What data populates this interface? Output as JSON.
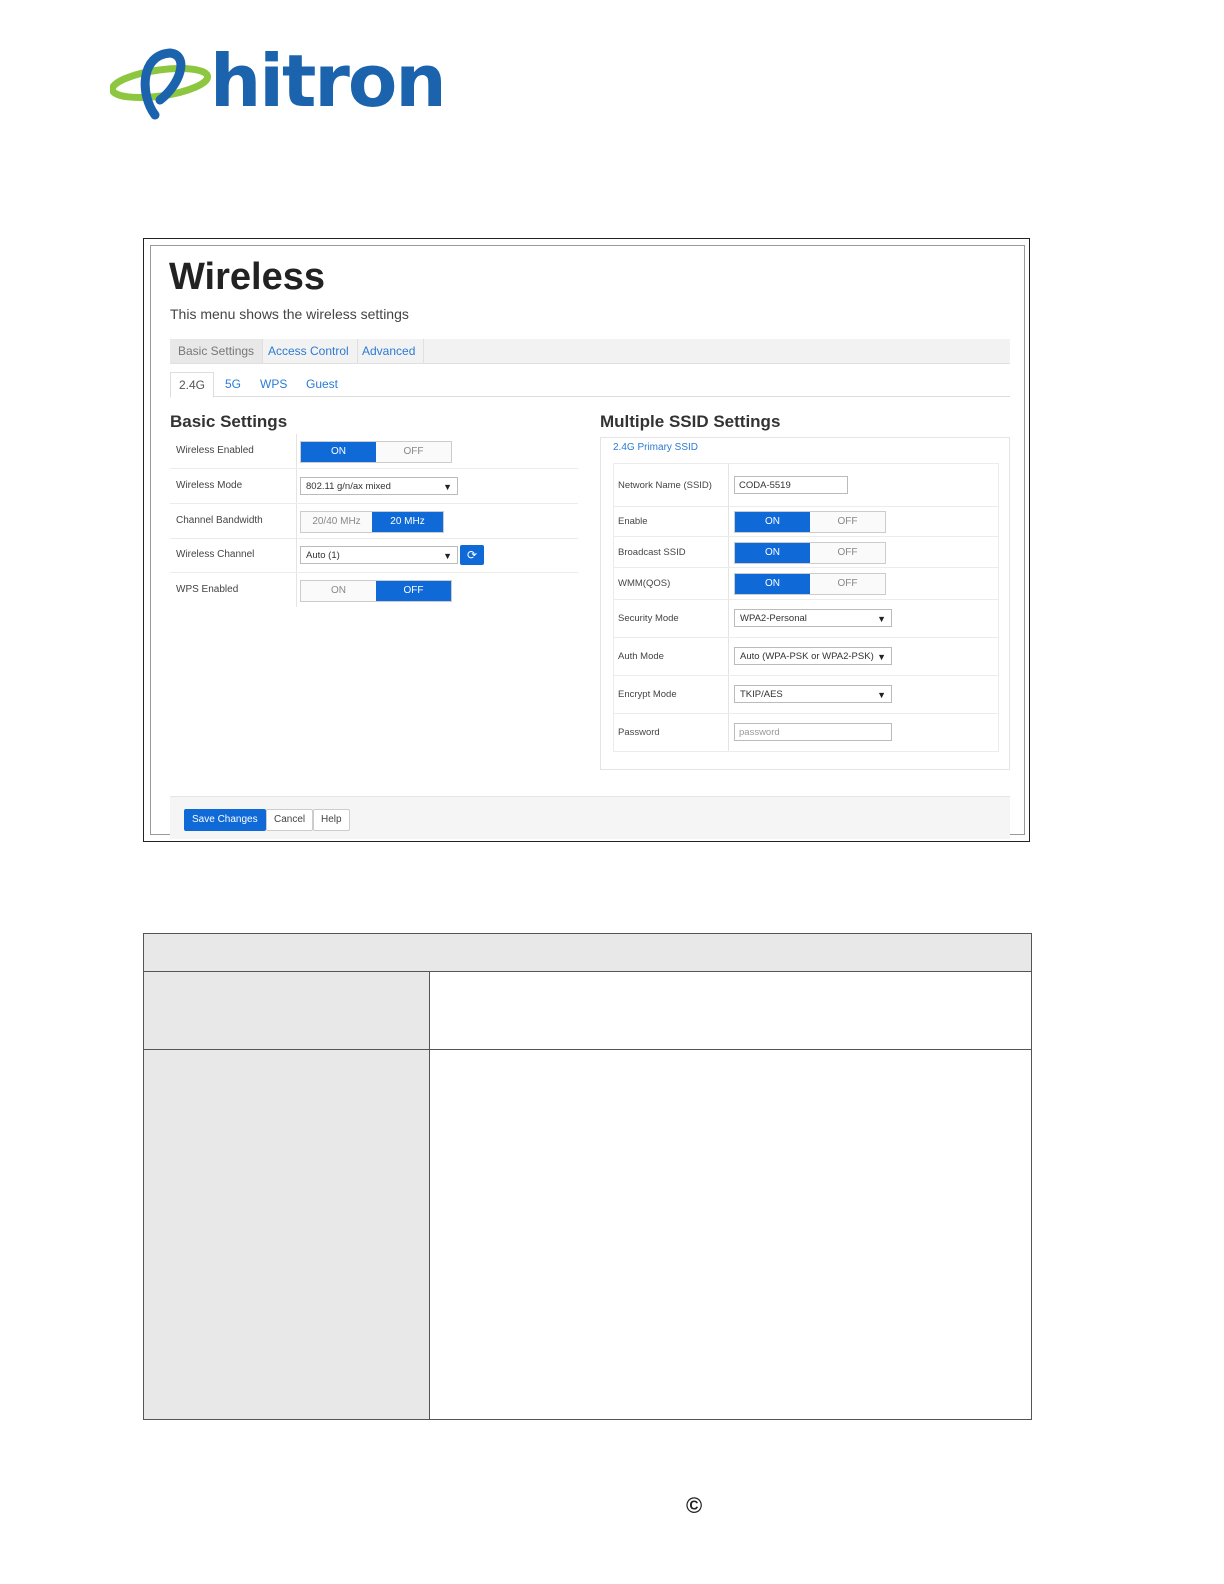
{
  "brand": {
    "name": "hitron",
    "primary_color": "#1b64ad",
    "accent_color": "#8dc63f"
  },
  "screen": {
    "title": "Wireless",
    "subtitle": "This menu shows the wireless settings",
    "top_tabs": [
      {
        "label": "Basic Settings",
        "active": true
      },
      {
        "label": "Access Control",
        "active": false
      },
      {
        "label": "Advanced",
        "active": false
      }
    ],
    "band_tabs": [
      {
        "label": "2.4G",
        "active": true
      },
      {
        "label": "5G",
        "active": false
      },
      {
        "label": "WPS",
        "active": false
      },
      {
        "label": "Guest",
        "active": false
      }
    ],
    "basic": {
      "title": "Basic Settings",
      "wireless_enabled": {
        "label": "Wireless Enabled",
        "on": "ON",
        "off": "OFF",
        "state": "on"
      },
      "wireless_mode": {
        "label": "Wireless Mode",
        "value": "802.11 g/n/ax mixed"
      },
      "channel_bandwidth": {
        "label": "Channel Bandwidth",
        "opt1": "20/40 MHz",
        "opt2": "20 MHz",
        "selected": "20 MHz"
      },
      "wireless_channel": {
        "label": "Wireless Channel",
        "value": "Auto (1)"
      },
      "wps_enabled": {
        "label": "WPS Enabled",
        "on": "ON",
        "off": "OFF",
        "state": "off"
      }
    },
    "ssid": {
      "title": "Multiple SSID Settings",
      "header": "2.4G Primary SSID",
      "network_name": {
        "label": "Network Name (SSID)",
        "value": "CODA-5519"
      },
      "enable": {
        "label": "Enable",
        "on": "ON",
        "off": "OFF",
        "state": "on"
      },
      "broadcast": {
        "label": "Broadcast SSID",
        "on": "ON",
        "off": "OFF",
        "state": "on"
      },
      "wmm": {
        "label": "WMM(QOS)",
        "on": "ON",
        "off": "OFF",
        "state": "on"
      },
      "security_mode": {
        "label": "Security Mode",
        "value": "WPA2-Personal"
      },
      "auth_mode": {
        "label": "Auth Mode",
        "value": "Auto (WPA-PSK or WPA2-PSK)"
      },
      "encrypt_mode": {
        "label": "Encrypt Mode",
        "value": "TKIP/AES"
      },
      "password": {
        "label": "Password",
        "placeholder": "password"
      }
    },
    "buttons": {
      "save": "Save Changes",
      "cancel": "Cancel",
      "help": "Help"
    }
  },
  "footer": {
    "copyright_symbol": "©"
  }
}
